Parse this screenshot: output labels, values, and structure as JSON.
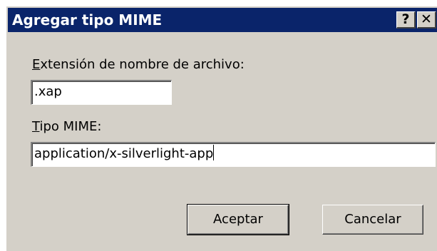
{
  "dialog": {
    "title": "Agregar tipo MIME",
    "help_glyph": "?",
    "close_glyph": "✕"
  },
  "fields": {
    "extension": {
      "label_mnemonic": "E",
      "label_rest": "xtensión de nombre de archivo:",
      "value": ".xap"
    },
    "mime": {
      "label_mnemonic": "T",
      "label_rest": "ipo MIME:",
      "value": "application/x-silverlight-app"
    }
  },
  "buttons": {
    "ok_label": "Aceptar",
    "cancel_label": "Cancelar"
  },
  "colors": {
    "titlebar": "#0a246a",
    "dialog_face": "#d4d0c8"
  }
}
